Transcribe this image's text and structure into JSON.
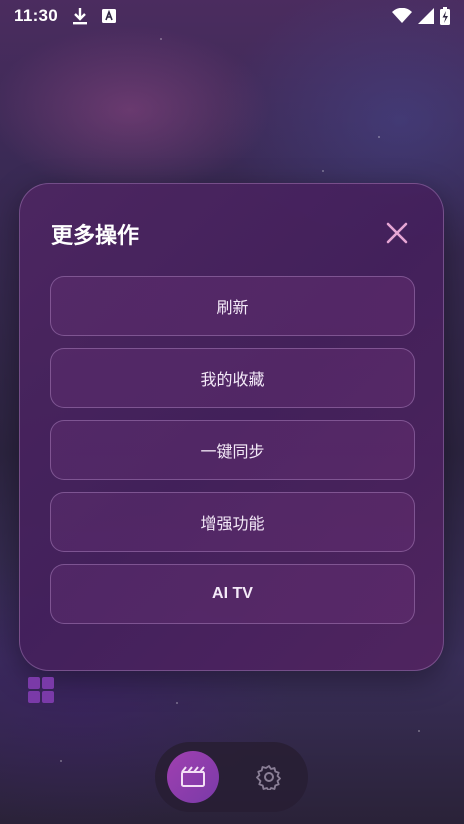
{
  "status_bar": {
    "time": "11:30",
    "icons": [
      "download-icon",
      "keyboard-a-icon",
      "wifi-icon",
      "signal-icon",
      "battery-charging-icon"
    ]
  },
  "modal": {
    "title": "更多操作",
    "close_icon": "close-icon",
    "actions": [
      {
        "label": "刷新"
      },
      {
        "label": "我的收藏"
      },
      {
        "label": "一键同步"
      },
      {
        "label": "增强功能"
      },
      {
        "label": "AI TV"
      }
    ]
  },
  "bottom_nav": {
    "items": [
      {
        "icon": "film-icon",
        "active": true
      },
      {
        "icon": "gear-icon",
        "active": false
      }
    ]
  },
  "colors": {
    "modal_border": "#c8a0dc",
    "nav_active": "#9a3eb0",
    "close_icon": "#e6a6d4",
    "grid_icon": "#7a3aa8"
  }
}
